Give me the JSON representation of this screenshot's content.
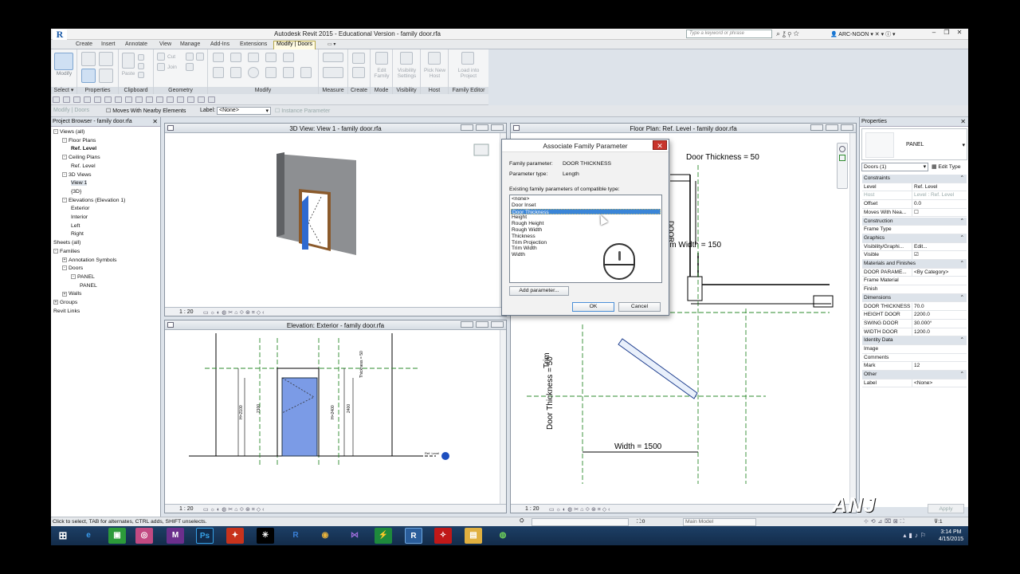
{
  "app": {
    "logo": "R",
    "title": "Autodesk Revit 2015 - Educational Version -     family door.rfa",
    "search_placeholder": "Type a keyword or phrase",
    "user": "ARC-NGON"
  },
  "tabs": [
    "Create",
    "Insert",
    "Annotate",
    "View",
    "Manage",
    "Add-Ins",
    "Extensions",
    "Modify | Doors"
  ],
  "ribbon": {
    "panels": [
      {
        "label": "Select ▾"
      },
      {
        "label": "Properties"
      },
      {
        "label": "Clipboard"
      },
      {
        "label": "Geometry"
      },
      {
        "label": "Modify"
      },
      {
        "label": "Measure"
      },
      {
        "label": "Create"
      },
      {
        "label": "Mode"
      },
      {
        "label": "Visibility"
      },
      {
        "label": "Host"
      },
      {
        "label": "Family Editor"
      }
    ],
    "buttons": {
      "modify": "Modify",
      "paste": "Paste",
      "cut": "Cut",
      "join": "Join",
      "edit_family": "Edit Family",
      "visibility_settings": "Visibility Settings",
      "pick_new_host": "Pick New Host",
      "load_into_project": "Load into Project"
    }
  },
  "options_bar": {
    "context": "Modify | Doors",
    "moves_with": "Moves With Nearby Elements",
    "label_caption": "Label:",
    "label_value": "<None>",
    "instance_param": "Instance Parameter"
  },
  "project_browser": {
    "title": "Project Browser - family door.rfa",
    "items": [
      {
        "text": "Views (all)",
        "level": 0,
        "exp": "-"
      },
      {
        "text": "Floor Plans",
        "level": 1,
        "exp": "-"
      },
      {
        "text": "Ref. Level",
        "level": 2,
        "bold": true
      },
      {
        "text": "Ceiling Plans",
        "level": 1,
        "exp": "-"
      },
      {
        "text": "Ref. Level",
        "level": 2
      },
      {
        "text": "3D Views",
        "level": 1,
        "exp": "-"
      },
      {
        "text": "View 1",
        "level": 2,
        "hl": true
      },
      {
        "text": "{3D}",
        "level": 2
      },
      {
        "text": "Elevations (Elevation 1)",
        "level": 1,
        "exp": "-"
      },
      {
        "text": "Exterior",
        "level": 2
      },
      {
        "text": "Interior",
        "level": 2
      },
      {
        "text": "Left",
        "level": 2
      },
      {
        "text": "Right",
        "level": 2
      },
      {
        "text": "Sheets (all)",
        "level": 0
      },
      {
        "text": "Families",
        "level": 0,
        "exp": "-"
      },
      {
        "text": "Annotation Symbols",
        "level": 1,
        "exp": "+"
      },
      {
        "text": "Doors",
        "level": 1,
        "exp": "-"
      },
      {
        "text": "PANEL",
        "level": 2,
        "exp": "-"
      },
      {
        "text": "PANEL",
        "level": 3
      },
      {
        "text": "Walls",
        "level": 1,
        "exp": "+"
      },
      {
        "text": "Groups",
        "level": 0,
        "exp": "+"
      },
      {
        "text": "Revit Links",
        "level": 0
      }
    ]
  },
  "views": {
    "v3d": {
      "title": "3D View: View 1 - family door.rfa",
      "scale": "1 : 20"
    },
    "elev": {
      "title": "Elevation: Exterior - family door.rfa",
      "scale": "1 : 20",
      "dims": [
        "H=2100",
        "2100",
        "H=2400",
        "2400",
        "2100",
        "2100",
        "Thickness = 50"
      ],
      "level_tag": "Ref. Level"
    },
    "plan": {
      "title": "Floor Plan: Ref. Level - family door.rfa",
      "scale": "1 : 20",
      "dims": [
        "Door Thickness = 50",
        "Trim Width = 150",
        "Door Thickness = 50",
        "Width = 1500",
        "Trim",
        "DOOR"
      ]
    }
  },
  "dialog": {
    "title": "Associate Family Parameter",
    "family_param_label": "Family parameter:",
    "family_param_value": "DOOR THICKNESS",
    "param_type_label": "Parameter type:",
    "param_type_value": "Length",
    "list_label": "Existing family parameters of compatible type:",
    "list": [
      "<none>",
      "Door Inset",
      "Door Thickness",
      "Height",
      "Rough Height",
      "Rough Width",
      "Thickness",
      "Trim Projection",
      "Trim Width",
      "Width"
    ],
    "selected_index": 2,
    "add_button": "Add parameter...",
    "ok": "OK",
    "cancel": "Cancel"
  },
  "properties": {
    "title": "Properties",
    "type_name": "PANEL",
    "selector": "Doors (1)",
    "edit_type": "Edit Type",
    "rows": [
      {
        "g": "Constraints"
      },
      {
        "k": "Level",
        "v": "Ref. Level"
      },
      {
        "k": "Host",
        "v": "Level : Ref. Level",
        "grey": true
      },
      {
        "k": "Offset",
        "v": "0.0"
      },
      {
        "k": "Moves With Nea...",
        "v": "☐"
      },
      {
        "g": "Construction"
      },
      {
        "k": "Frame Type",
        "v": ""
      },
      {
        "g": "Graphics"
      },
      {
        "k": "Visibility/Graphi...",
        "v": "Edit..."
      },
      {
        "k": "Visible",
        "v": "☑"
      },
      {
        "g": "Materials and Finishes"
      },
      {
        "k": "DOOR PARAME...",
        "v": "<By Category>"
      },
      {
        "k": "Frame Material",
        "v": ""
      },
      {
        "k": "Finish",
        "v": ""
      },
      {
        "g": "Dimensions"
      },
      {
        "k": "DOOR THICKNESS",
        "v": "70.0"
      },
      {
        "k": "HEIGHT DOOR",
        "v": "2200.0"
      },
      {
        "k": "SWING DOOR",
        "v": "30.000°"
      },
      {
        "k": "WIDTH DOOR",
        "v": "1200.0"
      },
      {
        "g": "Identity Data"
      },
      {
        "k": "Image",
        "v": ""
      },
      {
        "k": "Comments",
        "v": ""
      },
      {
        "k": "Mark",
        "v": "12"
      },
      {
        "g": "Other"
      },
      {
        "k": "Label",
        "v": "<None>"
      }
    ],
    "apply": "Apply"
  },
  "status": {
    "text": "Click to select, TAB for alternates, CTRL adds, SHIFT unselects.",
    "zero1": ":0",
    "model": "Main Model",
    "filter": ":1"
  },
  "taskbar": {
    "time": "3:14 PM",
    "date": "4/15/2015"
  },
  "watermark": "ANJ"
}
